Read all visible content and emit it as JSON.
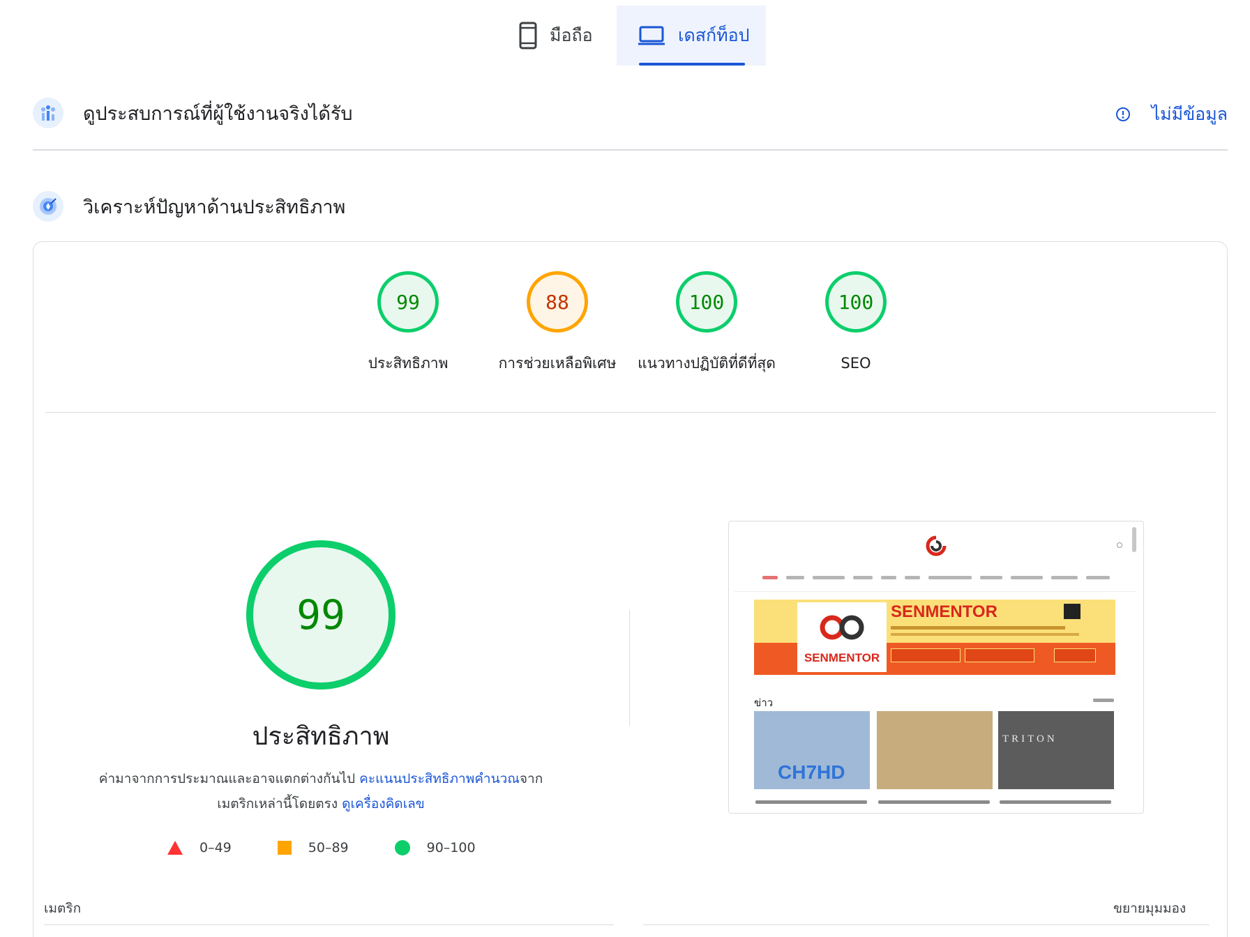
{
  "tabs": {
    "mobile_label": "มือถือ",
    "desktop_label": "เดสก์ท็อป",
    "selected": "desktop"
  },
  "crux": {
    "title": "ดูประสบการณ์ที่ผู้ใช้งานจริงได้รับ",
    "status": "ไม่มีข้อมูล"
  },
  "diagnose": {
    "title": "วิเคราะห์ปัญหาด้านประสิทธิภาพ"
  },
  "scores": [
    {
      "label": "ประสิทธิภาพ",
      "score": "99",
      "rating": "pass"
    },
    {
      "label": "การช่วยเหลือพิเศษ",
      "score": "88",
      "rating": "average"
    },
    {
      "label": "แนวทางปฏิบัติที่ดีที่สุด",
      "score": "100",
      "rating": "pass"
    },
    {
      "label": "SEO",
      "score": "100",
      "rating": "pass"
    }
  ],
  "performance": {
    "score": "99",
    "title": "ประสิทธิภาพ",
    "note_text": "ค่ามาจากการประมาณและอาจแตกต่างกันไป ",
    "note_link": "คะแนนประสิทธิภาพคำนวณ",
    "note_text2": "จาก",
    "note_text3": "เมตริกเหล่านี้โดยตรง ",
    "calculator_link": "ดูเครื่องคิดเลข"
  },
  "legend": {
    "fail": "0–49",
    "average": "50–89",
    "pass": "90–100"
  },
  "screenshot": {
    "banner_title": "SENMENTOR",
    "banner_logo_text": "SENMENTOR",
    "news_label": "ข่าว",
    "thumb1_text": "CH7HD",
    "thumb3_text": "TRITON"
  },
  "bottom": {
    "metrics_label": "เมตริก",
    "expand_view": "ขยายมุมมอง"
  },
  "colors": {
    "accent": "#1a56d6",
    "pass": "#0cce6b",
    "average": "#ffa400",
    "fail": "#ff3333"
  }
}
